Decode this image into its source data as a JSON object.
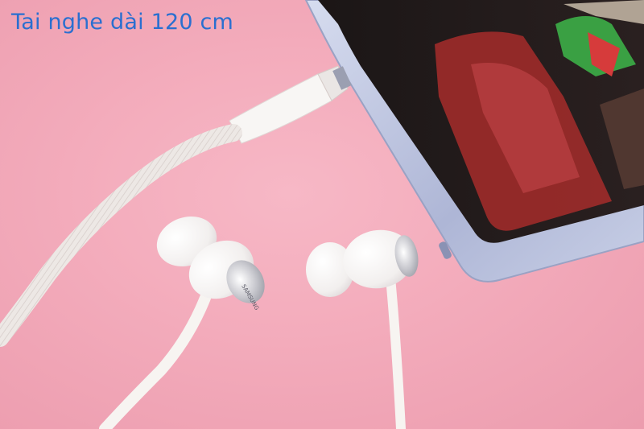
{
  "caption": {
    "text": "Tai nghe dài 120 cm"
  },
  "earbud_logo": {
    "text": "SAMSUNG"
  },
  "colors": {
    "background": "#f3abbb",
    "caption": "#2a6fd0",
    "cable": "#f7f4f1",
    "phone_frame": "#b9c0dc",
    "screen_red": "#9e2b2a",
    "screen_green": "#3aa043"
  },
  "objects": [
    "smartphone",
    "wired-earphones",
    "braided-cable",
    "audio-jack-plug"
  ]
}
